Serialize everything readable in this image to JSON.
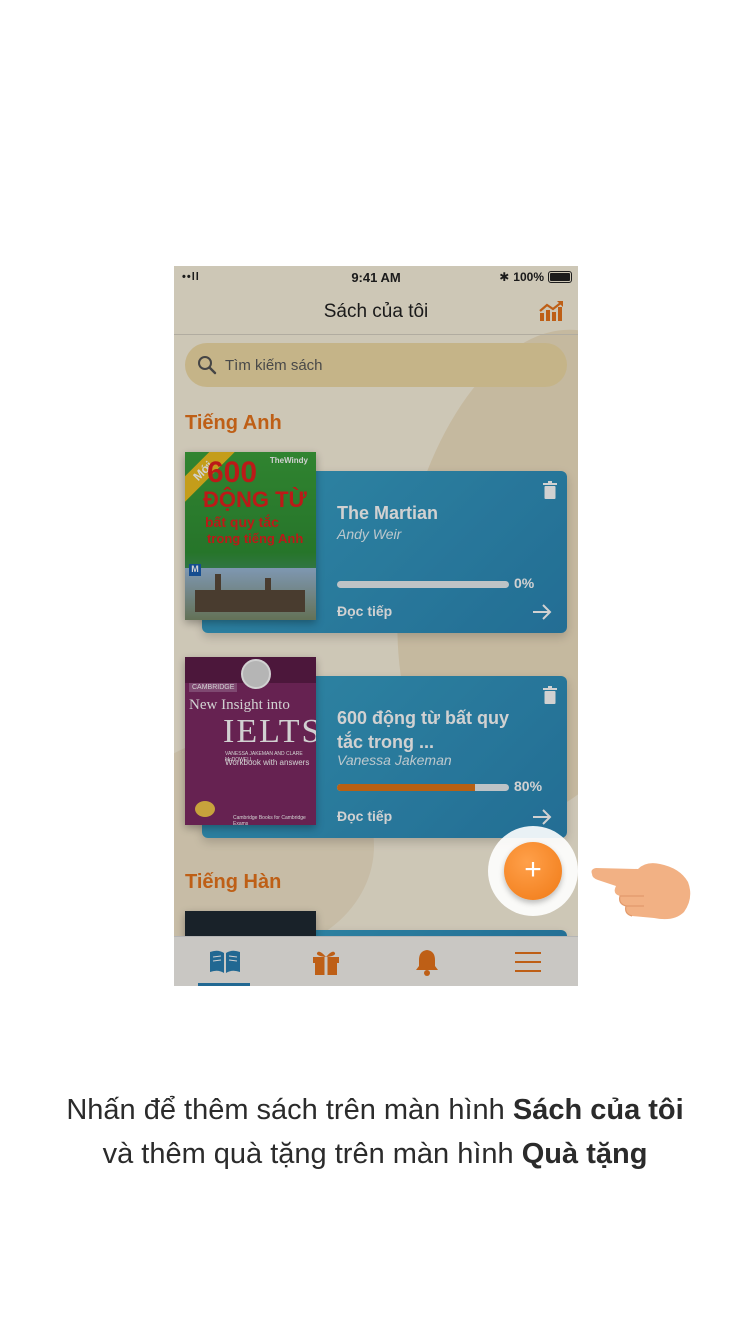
{
  "status_bar": {
    "signal": "••ll",
    "time": "9:41 AM",
    "bluetooth": "✱",
    "battery": "100%"
  },
  "header": {
    "title": "Sách của tôi"
  },
  "search": {
    "placeholder": "Tìm kiếm sách"
  },
  "sections": [
    {
      "title": "Tiếng Anh"
    },
    {
      "title": "Tiếng Hàn"
    }
  ],
  "books": [
    {
      "title": "The Martian",
      "author": "Andy Weir",
      "progress": 0,
      "progress_label": "0%",
      "action": "Đọc tiếp",
      "cover": {
        "badge": "Mới",
        "publisher": "TheWindy",
        "line1": "600",
        "line2": "ĐỘNG TỪ",
        "line3": "bất quy tắc",
        "line4": "trong tiếng Anh"
      }
    },
    {
      "title": "600 động từ bất quy tắc trong ...",
      "author": "Vanessa Jakeman",
      "progress": 80,
      "progress_label": "80%",
      "action": "Đọc tiếp",
      "cover": {
        "publisher": "CAMBRIDGE",
        "line1": "New Insight into",
        "line2": "IELTS",
        "line3": "VANESSA JAKEMAN AND CLARE McDOWELL",
        "line4": "Workbook with answers",
        "footer": "Cambridge Books for Cambridge Exams"
      }
    }
  ],
  "fab": {
    "label": "+"
  },
  "tabs": [
    {
      "name": "books",
      "icon": "book-icon"
    },
    {
      "name": "gifts",
      "icon": "gift-icon"
    },
    {
      "name": "notifications",
      "icon": "bell-icon"
    },
    {
      "name": "menu",
      "icon": "menu-icon"
    }
  ],
  "caption": {
    "line1_prefix": "Nhấn để thêm sách trên màn hình ",
    "line1_bold": "Sách của tôi",
    "line2_prefix": "và thêm quà tặng trên màn hình ",
    "line2_bold": "Quà tặng"
  },
  "colors": {
    "accent": "#e8741c",
    "card": "#2b86b5",
    "search_bg": "#f1dca6"
  }
}
